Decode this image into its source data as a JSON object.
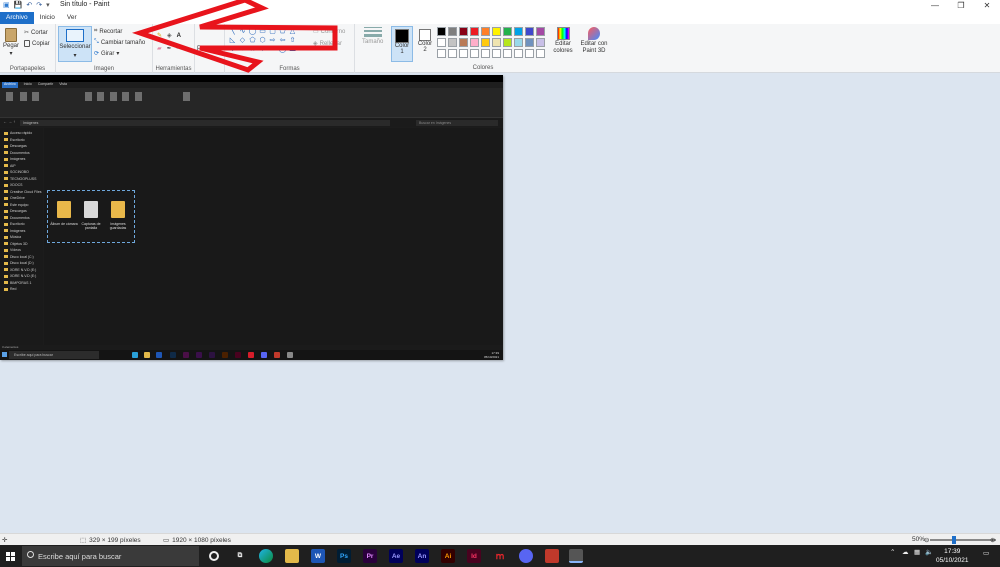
{
  "window": {
    "title": "Sin título - Paint",
    "controls": [
      "—",
      "❐",
      "✕"
    ]
  },
  "menu": {
    "tabs": [
      "Archivo",
      "Inicio",
      "Ver"
    ]
  },
  "ribbon": {
    "clipboard": {
      "paste": "Pegar",
      "cut": "Cortar",
      "copy": "Copiar",
      "group": "Portapapeles"
    },
    "image": {
      "select": "Seleccionar",
      "crop": "Recortar",
      "resize": "Cambiar tamaño",
      "rotate": "Girar",
      "group": "Imagen"
    },
    "tools": {
      "group": "Herramientas"
    },
    "brushes": {
      "label": "Pinceles"
    },
    "shapes": {
      "outline": "Contorno",
      "fill": "Rellenar",
      "group": "Formas"
    },
    "size": {
      "label": "Tamaño"
    },
    "color1": {
      "label": "Color",
      "num": "1"
    },
    "color2": {
      "label": "Color",
      "num": "2"
    },
    "colors": {
      "group": "Colores",
      "edit": "Editar colores",
      "row1": [
        "#000000",
        "#7f7f7f",
        "#880015",
        "#ed1c24",
        "#ff7f27",
        "#fff200",
        "#22b14c",
        "#00a2e8",
        "#3f48cc",
        "#a349a4"
      ],
      "row2": [
        "#ffffff",
        "#c3c3c3",
        "#b97a57",
        "#ffaec9",
        "#ffc90e",
        "#efe4b0",
        "#b5e61d",
        "#99d9ea",
        "#7092be",
        "#c8bfe7"
      ],
      "row3": [
        "#ffffff",
        "#ffffff",
        "#ffffff",
        "#ffffff",
        "#ffffff",
        "#ffffff",
        "#ffffff",
        "#ffffff",
        "#ffffff",
        "#ffffff"
      ]
    },
    "paint3d": "Editar con Paint 3D"
  },
  "canvas_image": {
    "tabs": [
      "Archivo",
      "Inicio",
      "Compartir",
      "Vista"
    ],
    "path": "Imágenes",
    "search": "Buscar en Imágenes",
    "nav": [
      "Acceso rápido",
      "Escritorio",
      "Descargas",
      "Documentos",
      "Imágenes",
      "AIP",
      "SOCINOBO",
      "TECNOOPLUSS",
      "XDOCS",
      "Creative Cloud Files",
      "OneDrive",
      "Este equipo",
      "Descargas",
      "Documentos",
      "Escritorio",
      "Imágenes",
      "Música",
      "Objetos 3D",
      "Vídeos",
      "Disco local (C:)",
      "Disco local (D:)",
      "XDRE N.V.D (E:)",
      "XDRE N.V.D (E:)",
      "BIMPORAS 1",
      "Red"
    ],
    "folders": [
      "Álbum de cámara",
      "Capturas de pantalla",
      "Imágenes guardadas"
    ],
    "status": "3 elementos",
    "taskbar_search": "Escribe aquí para buscar",
    "time": "17:39",
    "date": "05/10/2021"
  },
  "status": {
    "selection": "329 × 199 píxeles",
    "size": "1920 × 1080 píxeles",
    "zoom": "50%"
  },
  "taskbar": {
    "search": "Escribe aquí para buscar",
    "time": "17:39",
    "date": "05/10/2021"
  }
}
